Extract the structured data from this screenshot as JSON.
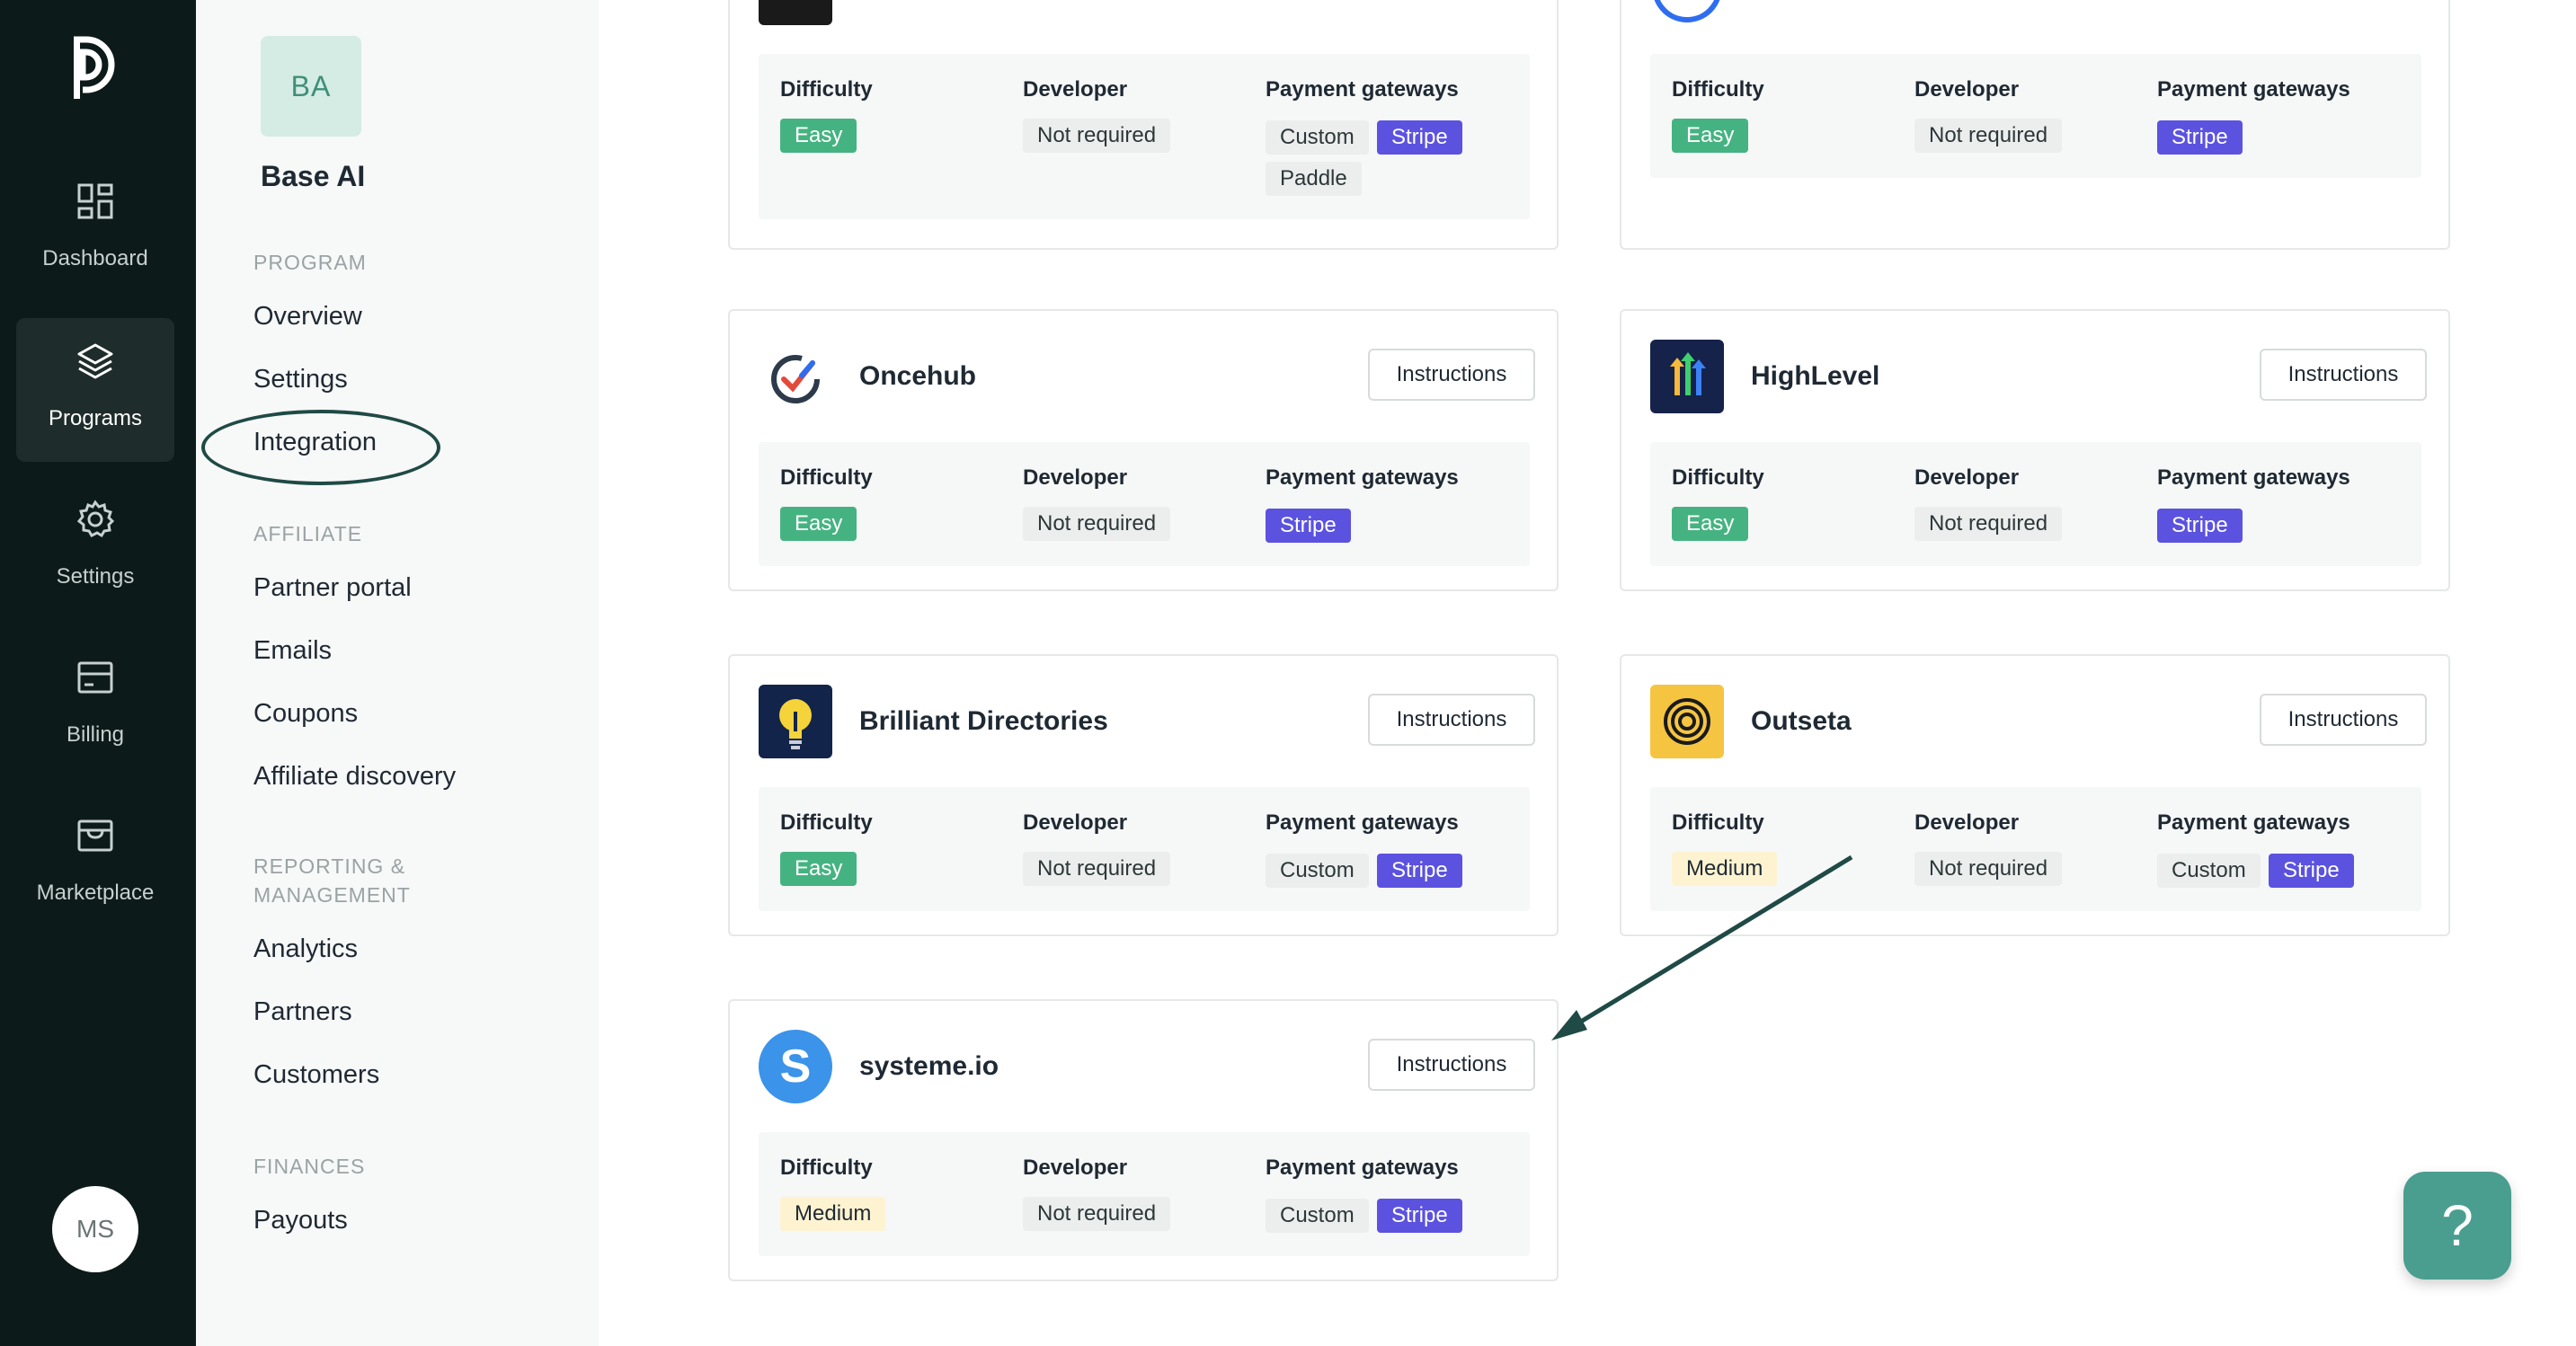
{
  "rail": {
    "items": [
      {
        "label": "Dashboard",
        "icon": "dashboard-icon"
      },
      {
        "label": "Programs",
        "icon": "layers-icon"
      },
      {
        "label": "Settings",
        "icon": "gear-icon"
      },
      {
        "label": "Billing",
        "icon": "billing-icon"
      },
      {
        "label": "Marketplace",
        "icon": "store-icon"
      }
    ],
    "user_initials": "MS"
  },
  "sidebar": {
    "company_initials": "BA",
    "company_name": "Base AI",
    "sections": [
      {
        "title": "PROGRAM",
        "items": [
          "Overview",
          "Settings",
          "Integration"
        ]
      },
      {
        "title": "AFFILIATE",
        "items": [
          "Partner portal",
          "Emails",
          "Coupons",
          "Affiliate discovery"
        ]
      },
      {
        "title": "REPORTING & MANAGEMENT",
        "items": [
          "Analytics",
          "Partners",
          "Customers"
        ]
      },
      {
        "title": "FINANCES",
        "items": [
          "Payouts"
        ]
      }
    ]
  },
  "labels": {
    "difficulty": "Difficulty",
    "developer": "Developer",
    "payment_gateways": "Payment gateways",
    "instructions": "Instructions"
  },
  "cards": [
    {
      "name": "",
      "difficulty": "Easy",
      "developer": "Not required",
      "gateways": [
        "Custom",
        "Stripe",
        "Paddle"
      ]
    },
    {
      "name": "",
      "difficulty": "Easy",
      "developer": "Not required",
      "gateways": [
        "Stripe"
      ]
    },
    {
      "name": "Oncehub",
      "difficulty": "Easy",
      "developer": "Not required",
      "gateways": [
        "Stripe"
      ]
    },
    {
      "name": "HighLevel",
      "difficulty": "Easy",
      "developer": "Not required",
      "gateways": [
        "Stripe"
      ]
    },
    {
      "name": "Brilliant Directories",
      "difficulty": "Easy",
      "developer": "Not required",
      "gateways": [
        "Custom",
        "Stripe"
      ]
    },
    {
      "name": "Outseta",
      "difficulty": "Medium",
      "developer": "Not required",
      "gateways": [
        "Custom",
        "Stripe"
      ]
    },
    {
      "name": "systeme.io",
      "difficulty": "Medium",
      "developer": "Not required",
      "gateways": [
        "Custom",
        "Stripe"
      ]
    }
  ],
  "help": {
    "label": "?"
  },
  "colors": {
    "rail_bg": "#0c1a19",
    "stripe": "#5b52e0",
    "easy": "#45b381",
    "medium": "#fdf3d1",
    "annotation": "#1f4a45"
  }
}
